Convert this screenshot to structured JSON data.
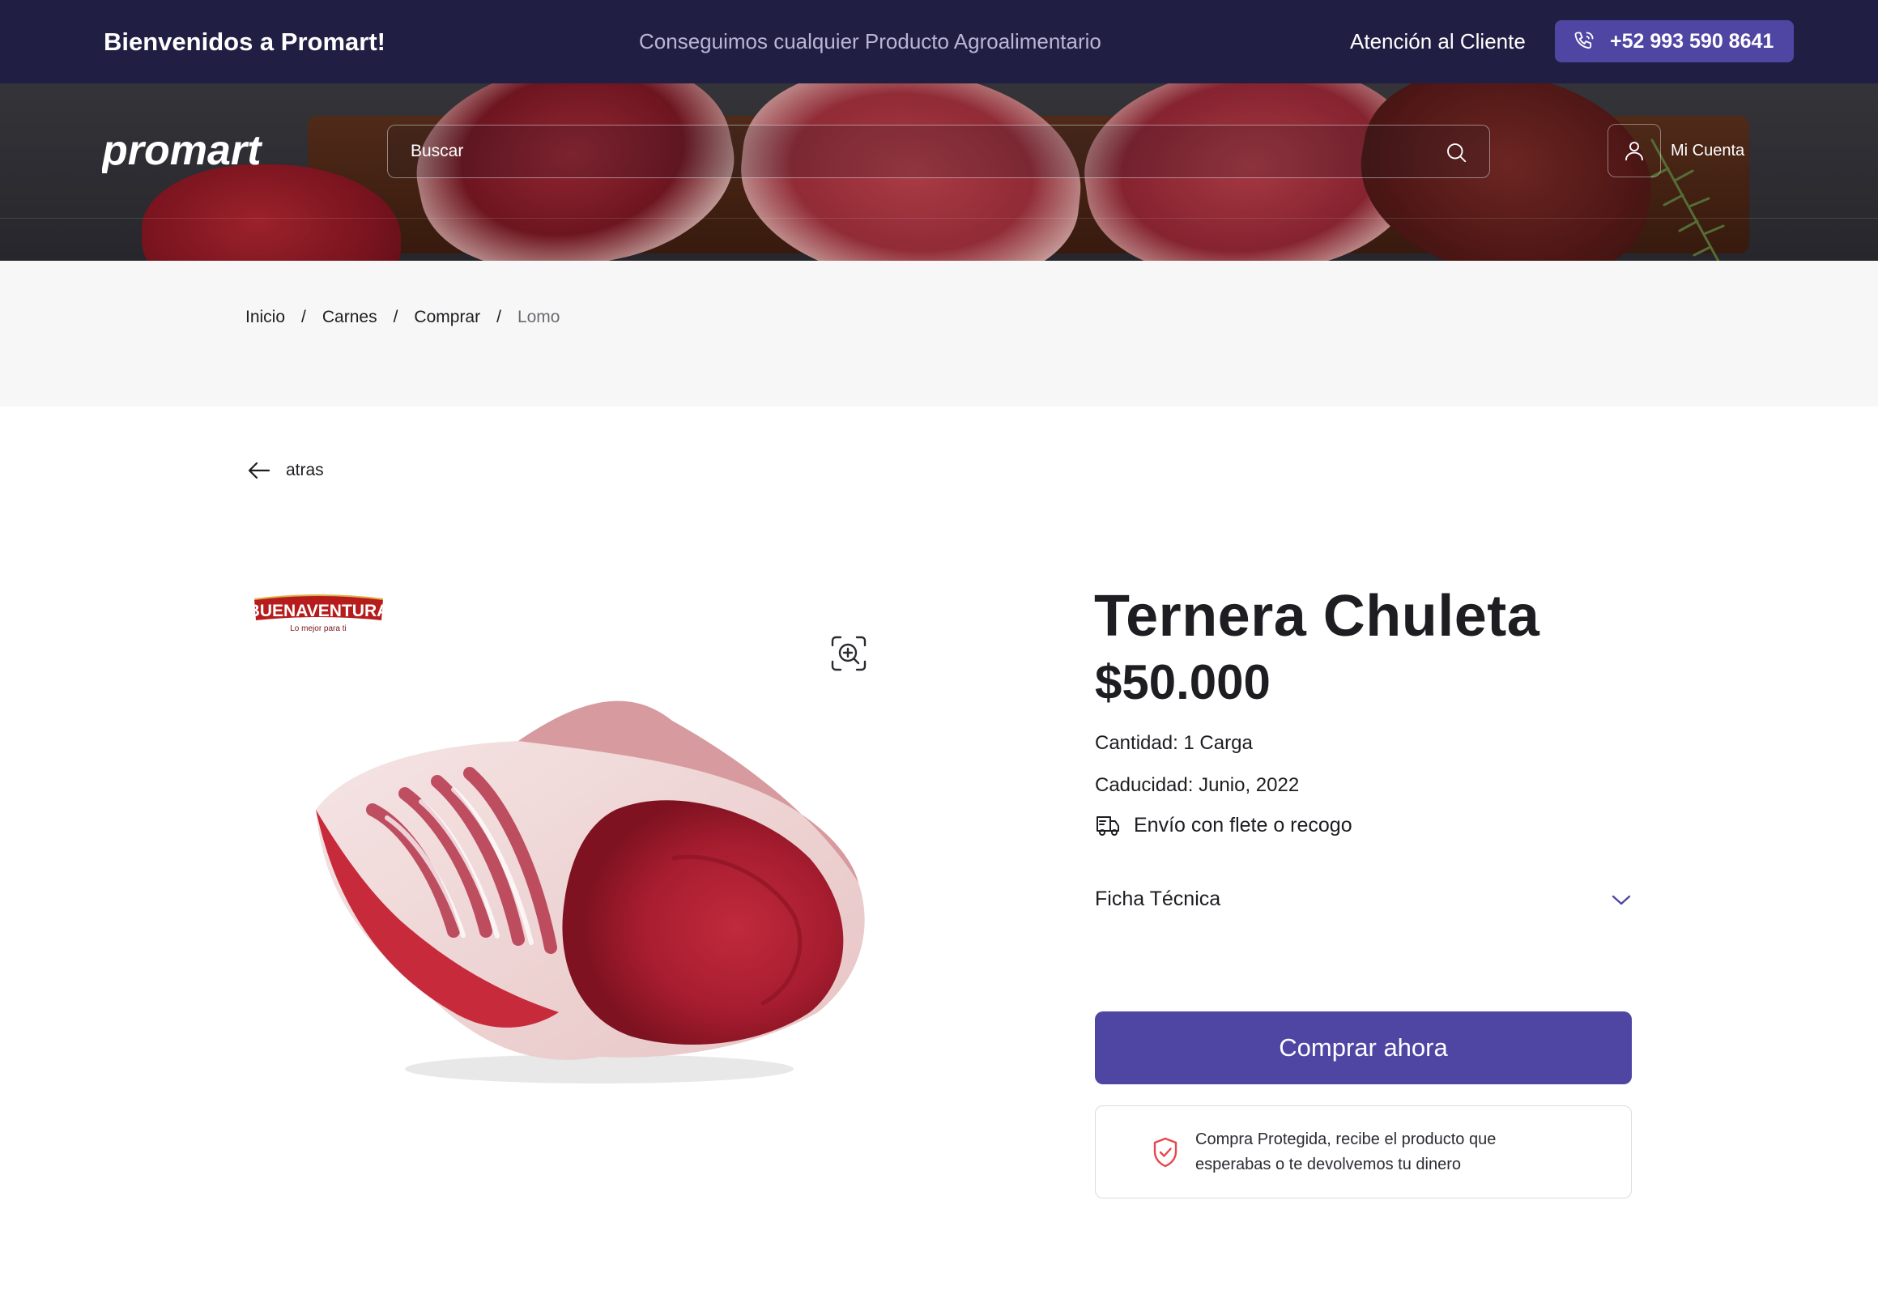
{
  "topbar": {
    "welcome": "Bienvenidos a Promart!",
    "tagline": "Conseguimos cualquier Producto Agroalimentario",
    "support": "Atención al Cliente",
    "phone": "+52 993 590 8641"
  },
  "header": {
    "logo_text": "promart",
    "search_placeholder": "Buscar",
    "account_label": "Mi Cuenta"
  },
  "breadcrumb": {
    "items": [
      "Inicio",
      "Carnes",
      "Comprar"
    ],
    "current": "Lomo",
    "separator": "/"
  },
  "back_label": "atras",
  "brand": {
    "name": "BUENAVENTURA",
    "slogan": "Lo mejor para ti"
  },
  "product": {
    "title": "Ternera Chuleta",
    "price": "$50.000",
    "quantity": "Cantidad: 1 Carga",
    "expiry": "Caducidad: Junio, 2022",
    "shipping": "Envío con flete o recogo",
    "spec_sheet": "Ficha Técnica",
    "buy_label": "Comprar ahora",
    "protection_text": "Compra Protegida, recibe el producto que esperabas o te devolvemos tu dinero"
  },
  "colors": {
    "topbar_bg": "#211e43",
    "accent": "#4f46a4",
    "protect_icon": "#e5484d",
    "crumb_band": "#f7f7f7"
  },
  "icons": [
    "phone-icon",
    "search-icon",
    "user-icon",
    "arrow-left-icon",
    "zoom-icon",
    "truck-icon",
    "chevron-down-icon",
    "shield-check-icon"
  ]
}
